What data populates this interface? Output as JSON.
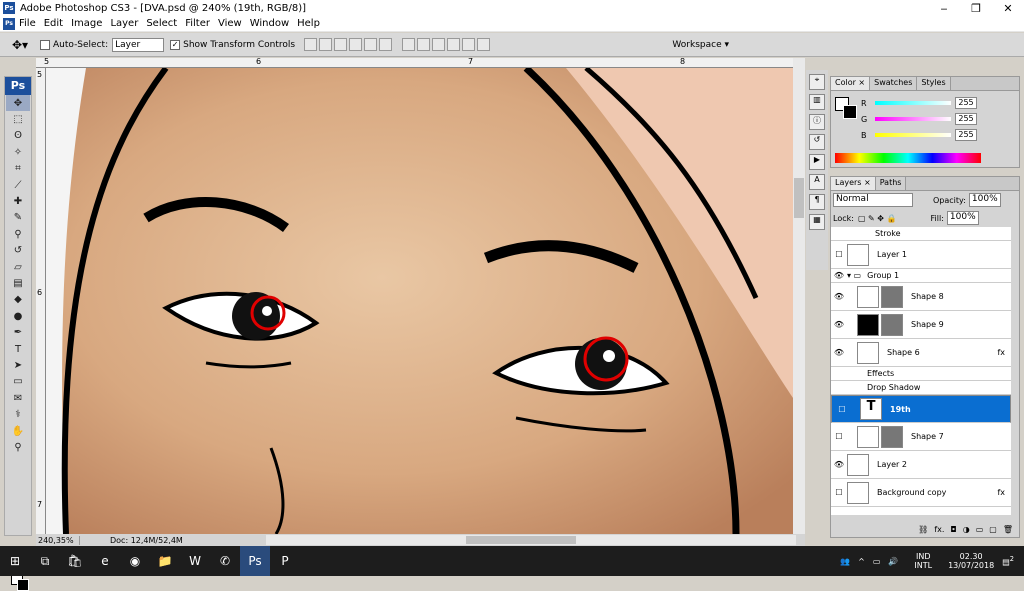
{
  "window": {
    "title": "Adobe Photoshop CS3 - [DVA.psd @ 240% (19th, RGB/8)]",
    "app_badge": "Ps",
    "controls": [
      "‒",
      "❐",
      "✕"
    ]
  },
  "menu": {
    "items": [
      "File",
      "Edit",
      "Image",
      "Layer",
      "Select",
      "Filter",
      "View",
      "Window",
      "Help"
    ]
  },
  "options": {
    "auto_select_label": "Auto-Select:",
    "auto_select_value": "Layer",
    "show_transform": "Show Transform Controls",
    "workspace": "Workspace ▾"
  },
  "rulers": {
    "h_ticks": [
      "5",
      "6",
      "7",
      "8"
    ],
    "v_ticks": [
      "5",
      "6",
      "7"
    ]
  },
  "status": {
    "zoom": "240,35%",
    "doc": "Doc: 12,4M/52,4M"
  },
  "color_panel": {
    "tabs": [
      "Color ×",
      "Swatches",
      "Styles"
    ],
    "channels": [
      {
        "name": "R",
        "value": "255"
      },
      {
        "name": "G",
        "value": "255"
      },
      {
        "name": "B",
        "value": "255"
      }
    ]
  },
  "layers_panel": {
    "tabs": [
      "Layers ×",
      "Paths"
    ],
    "blend": "Normal",
    "opacity_label": "Opacity:",
    "opacity": "100%",
    "lock_label": "Lock:",
    "fill_label": "Fill:",
    "fill": "100%",
    "layers": [
      {
        "name": "Stroke",
        "type": "effect"
      },
      {
        "name": "Layer 1",
        "type": "layer",
        "visible": false
      },
      {
        "name": "Group 1",
        "type": "group",
        "visible": true
      },
      {
        "name": "Shape 8",
        "type": "layer",
        "visible": true
      },
      {
        "name": "Shape 9",
        "type": "layer",
        "visible": true
      },
      {
        "name": "Shape 6",
        "type": "layer",
        "visible": true,
        "fx": "fx"
      },
      {
        "name": "Effects",
        "type": "effect"
      },
      {
        "name": "Drop Shadow",
        "type": "effect"
      },
      {
        "name": "19th",
        "type": "text",
        "visible": false,
        "selected": true
      },
      {
        "name": "Shape 7",
        "type": "layer",
        "visible": false
      },
      {
        "name": "Layer 2",
        "type": "layer",
        "visible": true
      },
      {
        "name": "Background copy",
        "type": "layer",
        "visible": false,
        "fx": "fx"
      }
    ]
  },
  "taskbar": {
    "tray": {
      "lang": "IND",
      "kb": "INTL",
      "time": "02.30",
      "date": "13/07/2018",
      "notif": "2"
    }
  }
}
